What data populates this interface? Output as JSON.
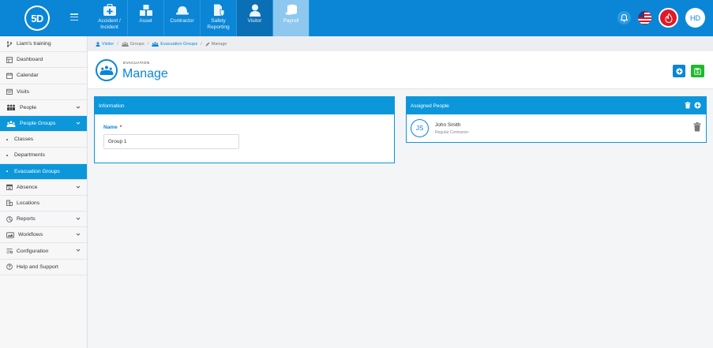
{
  "app": {
    "logo_text": "5D",
    "colors": {
      "primary": "#0b86d6",
      "header_blue": "#0b97da",
      "danger": "#e0192a",
      "success": "#1fb92e"
    }
  },
  "topnav": {
    "modules": [
      {
        "label": "Accident /\nIncident",
        "icon": "first-aid-kit-icon"
      },
      {
        "label": "Asset",
        "icon": "boxes-icon"
      },
      {
        "label": "Contractor",
        "icon": "hard-hat-icon"
      },
      {
        "label": "Safety\nReporting",
        "icon": "document-shield-icon"
      },
      {
        "label": "Visitor",
        "icon": "person-icon"
      },
      {
        "label": "Payroll",
        "icon": "coins-icon"
      }
    ],
    "user_initials": "HD"
  },
  "sidebar": {
    "items": [
      {
        "label": "Liam's training",
        "icon": "branch-icon"
      },
      {
        "label": "Dashboard",
        "icon": "dashboard-icon"
      },
      {
        "label": "Calendar",
        "icon": "calendar-icon"
      },
      {
        "label": "Visits",
        "icon": "visits-icon"
      },
      {
        "label": "People",
        "icon": "people-icon"
      },
      {
        "label": "People Groups",
        "icon": "people-group-icon"
      },
      {
        "label": "Classes"
      },
      {
        "label": "Departments"
      },
      {
        "label": "Evacuation Groups"
      },
      {
        "label": "Absence",
        "icon": "absence-icon"
      },
      {
        "label": "Locations",
        "icon": "locations-icon"
      },
      {
        "label": "Reports",
        "icon": "reports-icon"
      },
      {
        "label": "Workflows",
        "icon": "workflows-icon"
      },
      {
        "label": "Configuration",
        "icon": "configuration-icon"
      },
      {
        "label": "Help and Support",
        "icon": "help-icon"
      }
    ]
  },
  "breadcrumb": {
    "items": [
      "Visitor",
      "Groups",
      "Evacuation Groups",
      "Manage"
    ]
  },
  "page": {
    "subtitle": "EVACUATION",
    "title": "Manage"
  },
  "information": {
    "header": "Information",
    "name_label": "Name",
    "name_required": "*",
    "name_value": "Group 1"
  },
  "assigned": {
    "header": "Assigned People",
    "people": [
      {
        "initials": "JS",
        "name": "John Smith",
        "role": "Regular Contractor"
      }
    ]
  }
}
